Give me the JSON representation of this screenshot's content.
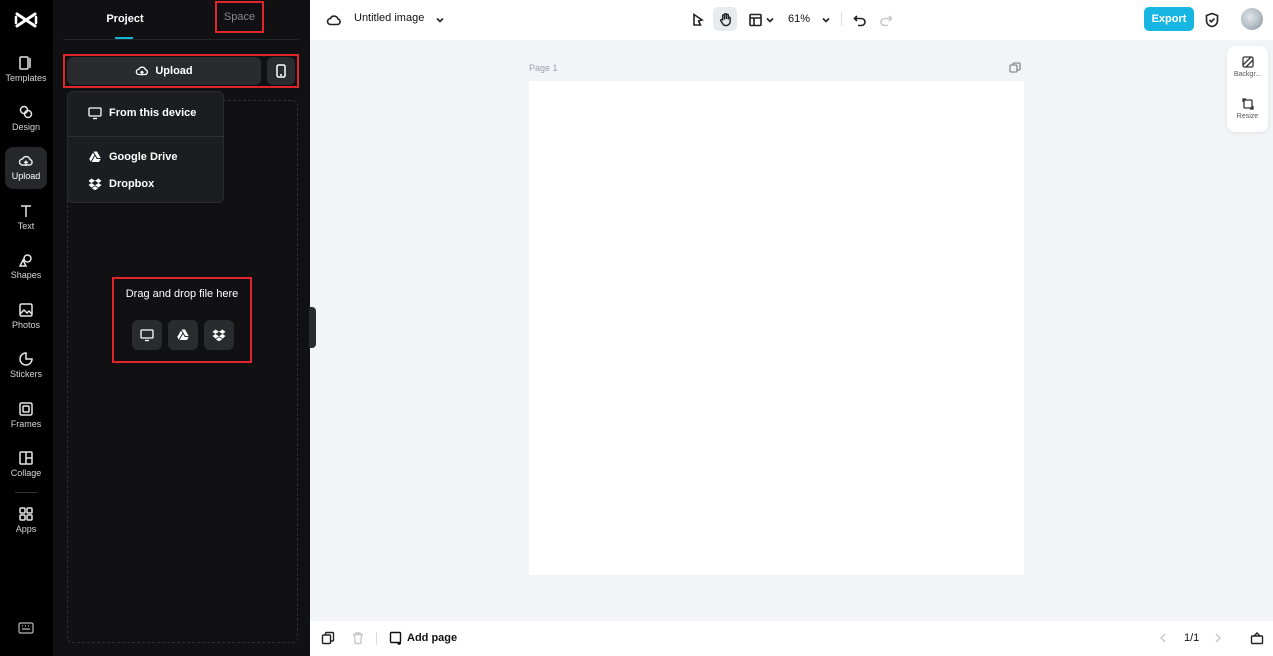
{
  "rail": {
    "items": [
      {
        "label": "Templates"
      },
      {
        "label": "Design"
      },
      {
        "label": "Upload"
      },
      {
        "label": "Text"
      },
      {
        "label": "Shapes"
      },
      {
        "label": "Photos"
      },
      {
        "label": "Stickers"
      },
      {
        "label": "Frames"
      },
      {
        "label": "Collage"
      },
      {
        "label": "Apps"
      }
    ],
    "active": "Upload"
  },
  "panel": {
    "tabs": [
      {
        "label": "Project"
      },
      {
        "label": "Space"
      }
    ],
    "upload_label": "Upload",
    "menu": [
      {
        "label": "From this device",
        "icon": "monitor-icon"
      },
      {
        "label": "Google Drive",
        "icon": "google-drive-icon"
      },
      {
        "label": "Dropbox",
        "icon": "dropbox-icon"
      }
    ],
    "drag_label": "Drag and drop file here"
  },
  "topbar": {
    "title": "Untitled image",
    "zoom": "61%",
    "export_label": "Export"
  },
  "canvas": {
    "page_label": "Page 1"
  },
  "right_panel": {
    "items": [
      {
        "label": "Backgr..."
      },
      {
        "label": "Resize"
      }
    ]
  },
  "bottombar": {
    "add_page_label": "Add page",
    "page_counter": "1/1"
  },
  "colors": {
    "accent": "#17b6e2",
    "highlight": "#e0262b",
    "rail_bg": "#000000",
    "panel_bg": "#111113",
    "canvas_bg": "#f2f4f7"
  }
}
